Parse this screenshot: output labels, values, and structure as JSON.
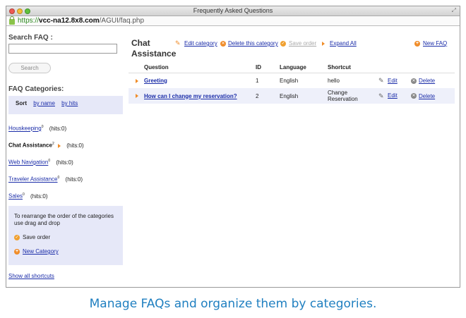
{
  "window": {
    "title": "Frequently Asked Questions",
    "url_scheme": "https://",
    "url_host": "vcc-na12.8x8.com",
    "url_path": "/AGUI/faq.php"
  },
  "sidebar": {
    "search_label": "Search FAQ :",
    "search_value": "",
    "search_button": "Search",
    "categories_heading": "FAQ Categories:",
    "sort_label": "Sort",
    "sort_by_name": "by name",
    "sort_by_hits": "by hits",
    "categories": [
      {
        "name": "Houskeeping",
        "count": "0",
        "hits": "(hits:0)",
        "active": false
      },
      {
        "name": "Chat Assistance",
        "count": "2",
        "hits": "(hits:0)",
        "active": true
      },
      {
        "name": "Web Navigation",
        "count": "0",
        "hits": "(hits:0)",
        "active": false
      },
      {
        "name": "Traveler Assistance",
        "count": "0",
        "hits": "(hits:0)",
        "active": false
      },
      {
        "name": "Sales",
        "count": "0",
        "hits": "(hits:0)",
        "active": false
      }
    ],
    "rearrange_text_1": "To rearrange the order of the categories",
    "rearrange_text_2": "use drag and drop",
    "save_order": "Save order",
    "new_category": "New Category",
    "show_all_shortcuts": "Show all shortcuts"
  },
  "main": {
    "title_line1": "Chat",
    "title_line2": "Assistance",
    "edit_category": "Edit category",
    "delete_category": "Delete this category",
    "save_order": "Save order",
    "expand_all": "Expand All",
    "new_faq": "New FAQ",
    "table": {
      "headers": {
        "question": "Question",
        "id": "ID",
        "language": "Language",
        "shortcut": "Shortcut"
      },
      "rows": [
        {
          "question": "Greeting",
          "id": "1",
          "language": "English",
          "shortcut": "hello",
          "edit": "Edit",
          "delete": "Delete"
        },
        {
          "question": "How can I change my reservation?",
          "id": "2",
          "language": "English",
          "shortcut_line1": "Change",
          "shortcut_line2": "Reservation",
          "edit": "Edit",
          "delete": "Delete"
        }
      ]
    }
  },
  "caption": "Manage FAQs and organize them by categories.",
  "colors": {
    "link": "#1a2ca8",
    "accent_orange": "#f08c28",
    "panel_bg": "#e6e8f8",
    "caption": "#1f7fc0"
  }
}
